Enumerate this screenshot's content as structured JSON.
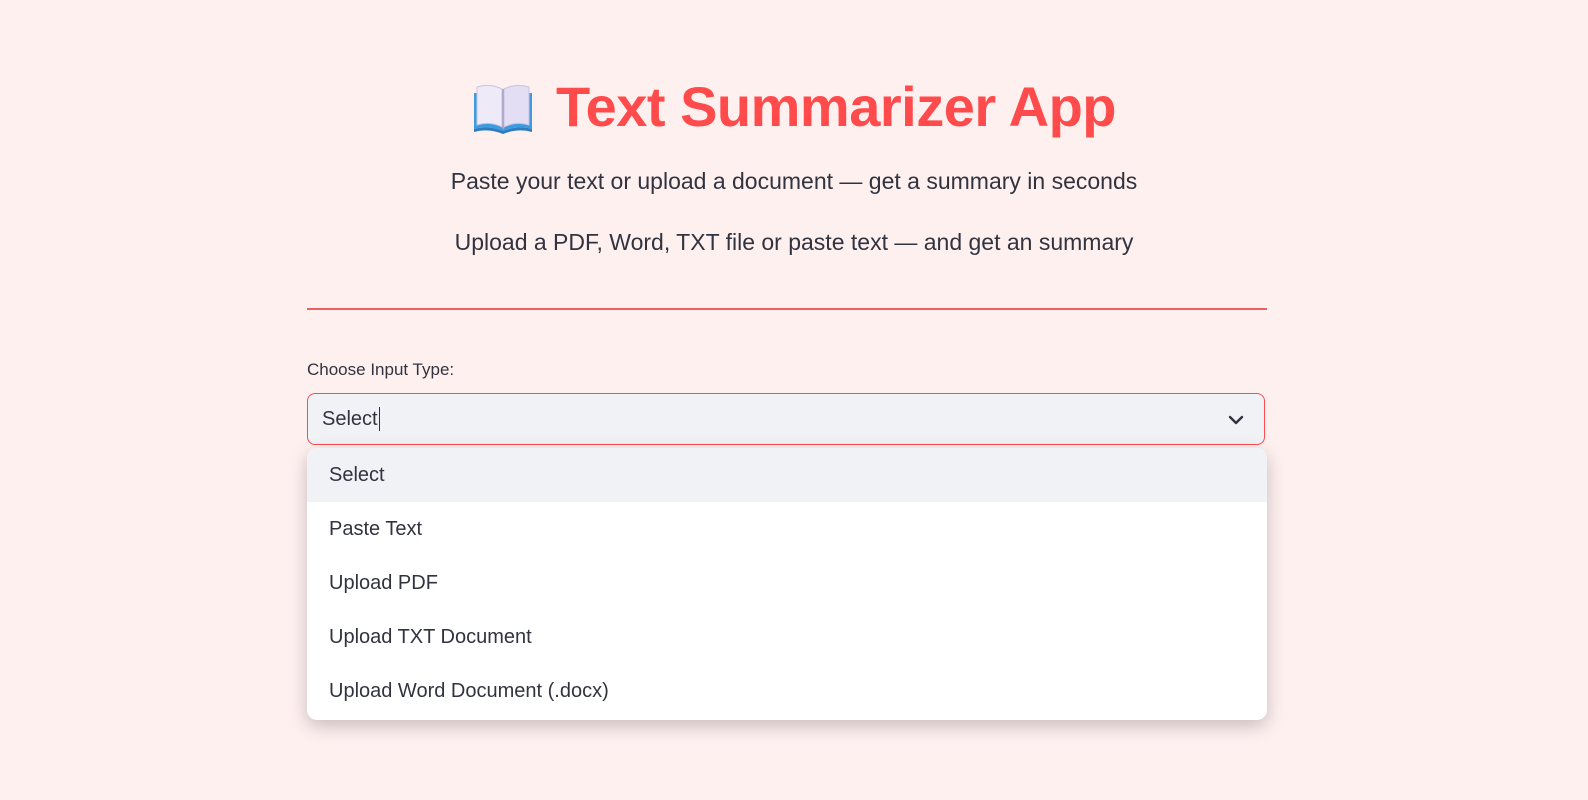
{
  "header": {
    "title": "Text Summarizer App",
    "icon": "open-book-icon",
    "subtitle_1": "Paste your text or upload a document — get a summary in seconds",
    "subtitle_2": "Upload a PDF, Word, TXT file or paste text — and get an summary"
  },
  "input_type": {
    "label": "Choose Input Type:",
    "selected": "Select",
    "options": [
      "Select",
      "Paste Text",
      "Upload PDF",
      "Upload TXT Document",
      "Upload Word Document (.docx)"
    ]
  },
  "colors": {
    "accent": "#ff4b4b",
    "background": "#fff0f0",
    "text": "#31333f",
    "field_bg": "#f0f2f6"
  }
}
